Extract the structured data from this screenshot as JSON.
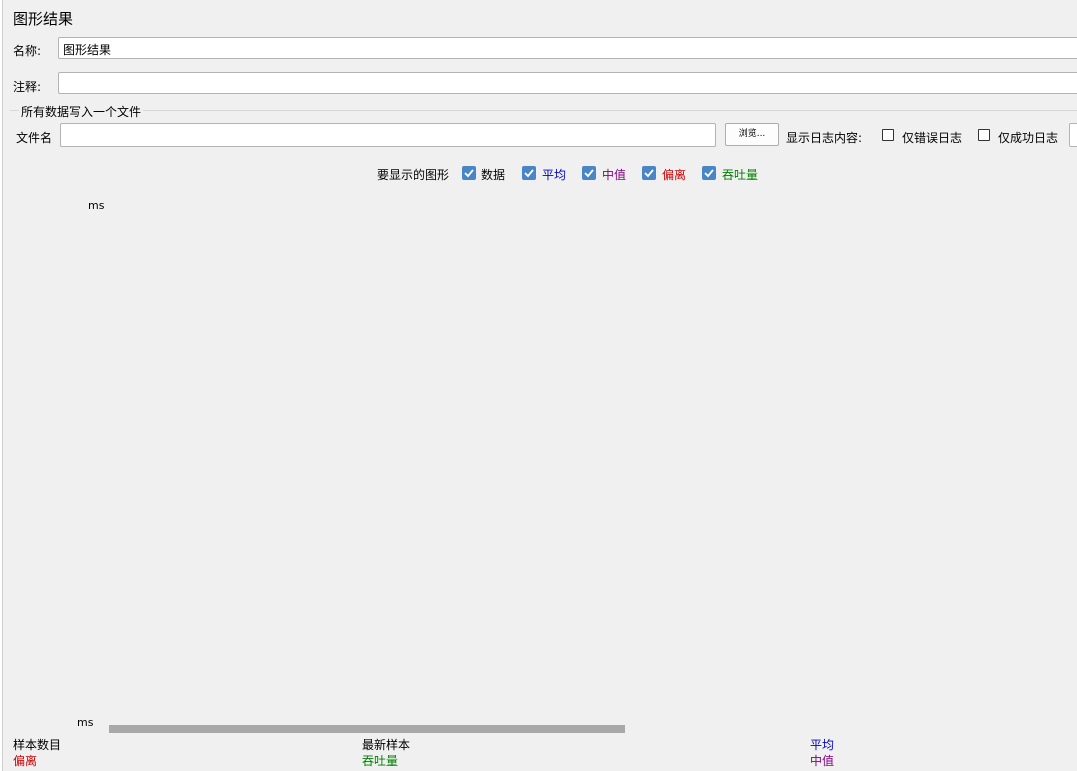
{
  "window_title": "图形结果",
  "name_label": "名称:",
  "name_value": "图形结果",
  "comment_label": "注释:",
  "comment_value": "",
  "file_group_title": "所有数据写入一个文件",
  "filename_label": "文件名",
  "filename_value": "",
  "browse_label": "浏览...",
  "log_content_label": "显示日志内容:",
  "errors_only_label": "仅错误日志",
  "success_only_label": "仅成功日志",
  "graphs_label": "要显示的图形",
  "graph_options": [
    {
      "label": "数据",
      "color": "#000000",
      "checked": true
    },
    {
      "label": "平均",
      "color": "#0000cc",
      "checked": true
    },
    {
      "label": "中值",
      "color": "#800080",
      "checked": true
    },
    {
      "label": "偏离",
      "color": "#cc0000",
      "checked": true
    },
    {
      "label": "吞吐量",
      "color": "#008000",
      "checked": true
    }
  ],
  "chart": {
    "y_unit_top": "ms",
    "y_unit_bottom": "ms"
  },
  "stats": {
    "sample_count": "样本数目",
    "latest_sample": "最新样本",
    "average": "平均",
    "deviation": "偏离",
    "throughput": "吞吐量",
    "median": "中值"
  }
}
